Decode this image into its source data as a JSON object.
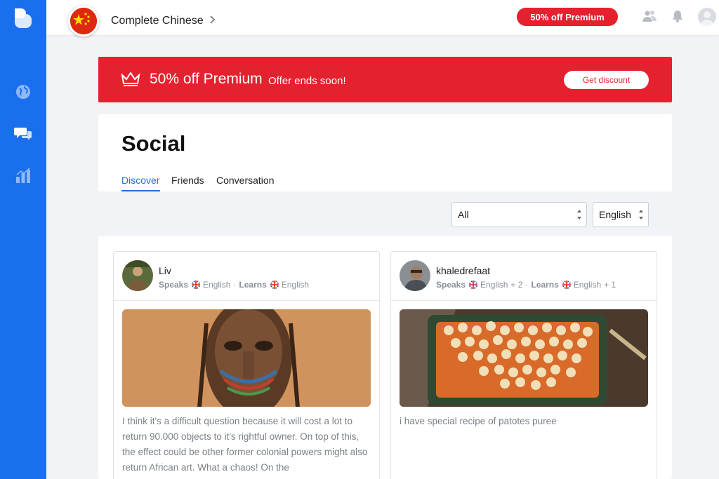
{
  "course": {
    "title": "Complete Chinese"
  },
  "topbar": {
    "premium_label": "50% off Premium"
  },
  "banner": {
    "title": "50% off Premium",
    "subtitle": "Offer ends soon!",
    "button": "Get discount"
  },
  "social": {
    "title": "Social",
    "tabs": [
      "Discover",
      "Friends",
      "Conversation"
    ],
    "active_tab": "Discover",
    "filters": {
      "type": "All",
      "language": "English"
    }
  },
  "posts": [
    {
      "username": "Liv",
      "speaks_label": "Speaks",
      "speaks_lang": "English",
      "speaks_extra": "",
      "learns_label": "Learns",
      "learns_lang": "English",
      "learns_extra": "",
      "text": "I think it's a difficult question because it will cost a lot to return 90.000 objects to it's rightful owner. On top of this, the effect could be other former colonial powers might also return African art. What a chaos! On the"
    },
    {
      "username": "khaledrefaat",
      "speaks_label": "Speaks",
      "speaks_lang": "English",
      "speaks_extra": "+ 2",
      "learns_label": "Learns",
      "learns_lang": "English",
      "learns_extra": "+ 1",
      "text": "i have special recipe of patotes puree"
    }
  ],
  "colors": {
    "brand_blue": "#1a6fed",
    "premium_red": "#e4222f",
    "tab_active": "#2a6bd5"
  },
  "icons": [
    "app-logo-icon",
    "globe-icon",
    "chat-icon",
    "stats-icon",
    "friends-icon",
    "bell-icon",
    "crown-icon",
    "chevron-right-icon"
  ]
}
